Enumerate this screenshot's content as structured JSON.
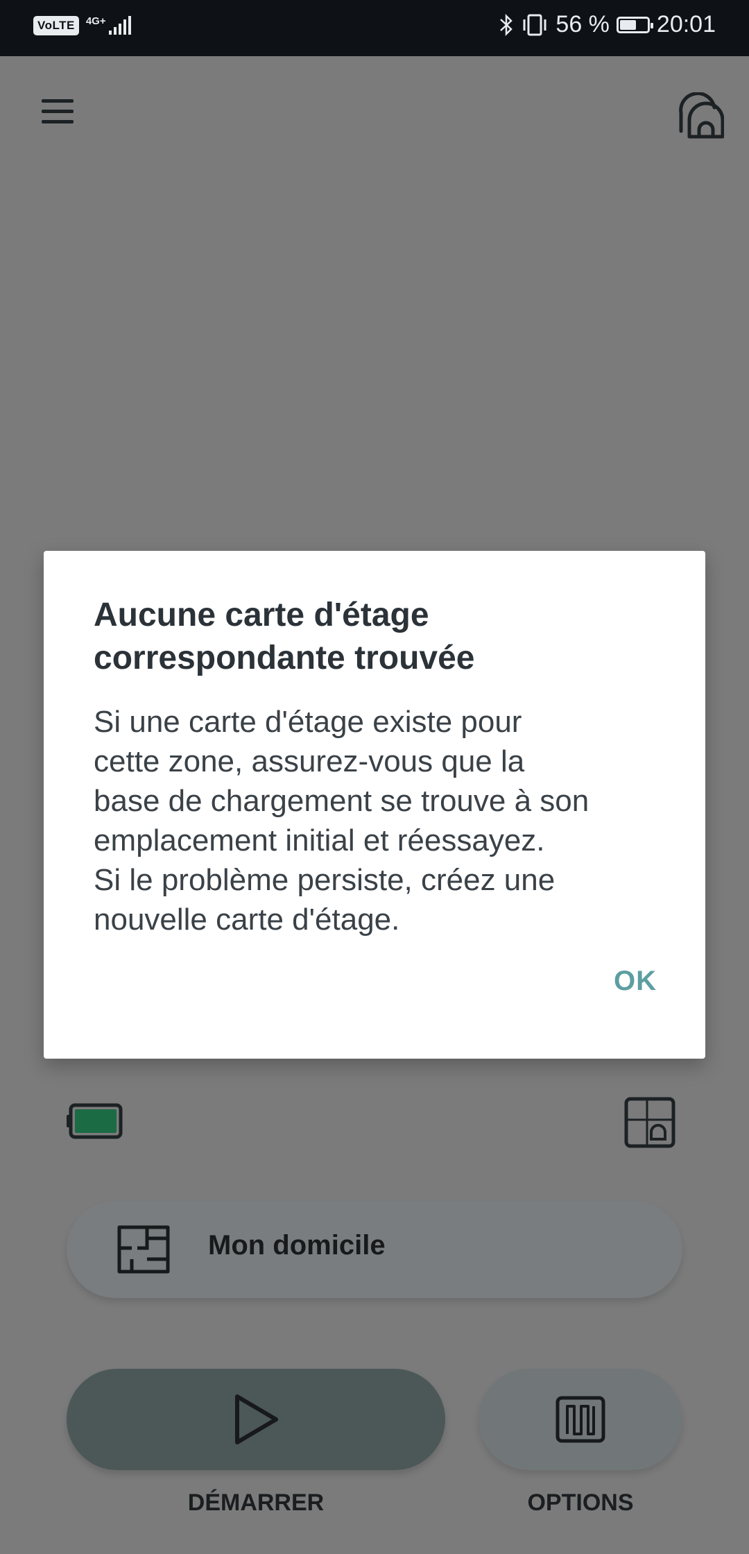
{
  "status_bar": {
    "volte": "VoLTE",
    "network": "4G+",
    "battery_percent_text": "56 %",
    "battery_level": 0.56,
    "time": "20:01",
    "icons": [
      "bluetooth-icon",
      "vibrate-icon",
      "signal-icon",
      "battery-icon"
    ]
  },
  "header": {
    "menu_icon": "menu-icon",
    "robot_icon": "robot-home-icon"
  },
  "status_row": {
    "battery_icon": "robot-battery-icon",
    "map_icon": "map-dock-icon",
    "battery_color": "#1b6b45"
  },
  "home": {
    "label": "Mon domicile",
    "icon": "floor-plan-icon"
  },
  "actions": {
    "start_label": "DÉMARRER",
    "options_label": "OPTIONS"
  },
  "dialog": {
    "title": "Aucune carte d'étage correspondante trouvée",
    "body": "Si une carte d'étage existe pour\ncette zone, assurez-vous que la\nbase de chargement se trouve à son\nemplacement initial et réessayez.\nSi le problème persiste, créez une\nnouvelle carte d'étage.",
    "ok_label": "OK",
    "accent_color": "#5d9ea1"
  }
}
